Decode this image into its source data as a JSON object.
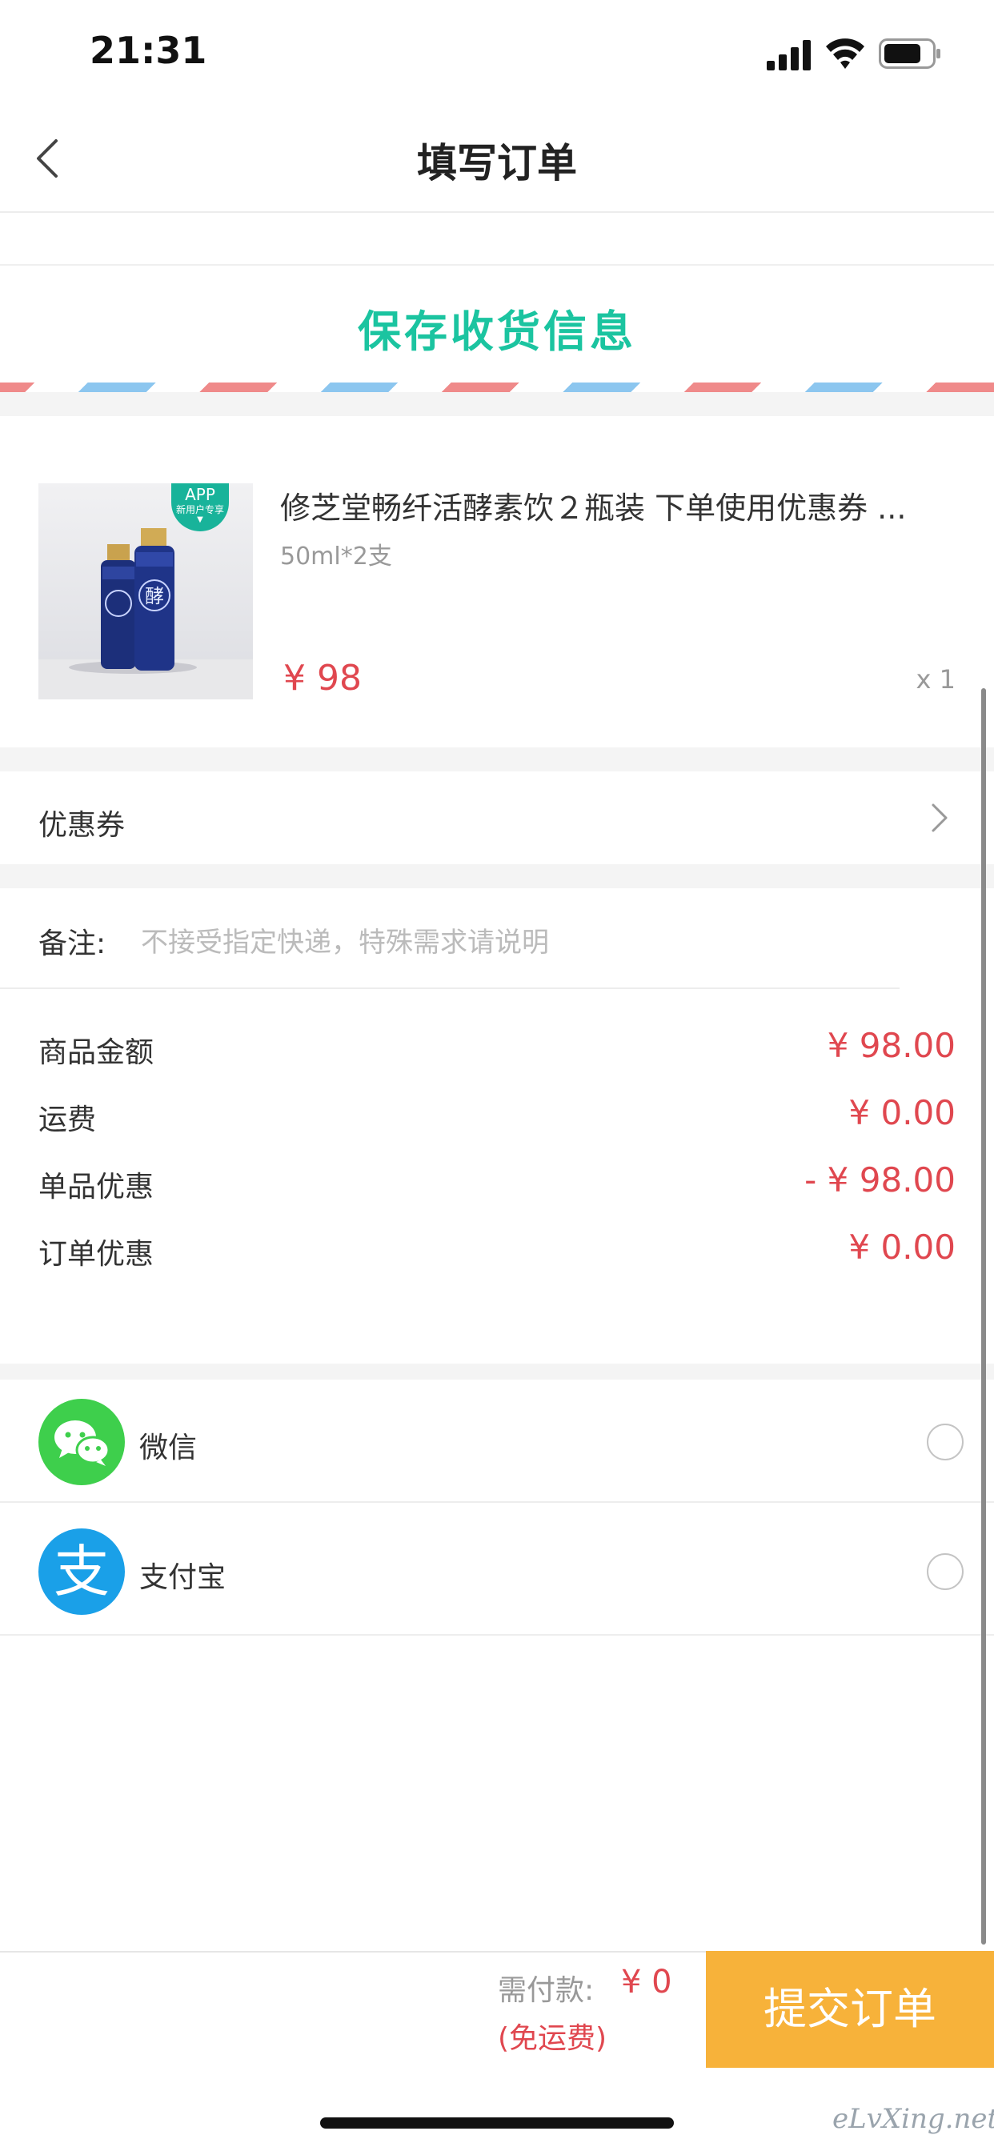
{
  "status_bar": {
    "time": "21:31"
  },
  "nav": {
    "title": "填写订单"
  },
  "address": {
    "save_label": "保存收货信息"
  },
  "product": {
    "name": "修芝堂畅纤活酵素饮２瓶装  下单使用优惠券 ...",
    "spec": "50ml*2支",
    "price": "¥ 98",
    "quantity": "x 1",
    "badge_line1": "APP",
    "badge_line2": "新用户专享",
    "bottle_char": "酵"
  },
  "coupon": {
    "label": "优惠券"
  },
  "note": {
    "label": "备注:",
    "placeholder": "不接受指定快递，特殊需求请说明"
  },
  "summary": [
    {
      "label": "商品金额",
      "value": "¥ 98.00"
    },
    {
      "label": "运费",
      "value": "¥ 0.00"
    },
    {
      "label": "单品优惠",
      "value": "- ¥ 98.00"
    },
    {
      "label": "订单优惠",
      "value": "¥ 0.00"
    }
  ],
  "payment": {
    "methods": [
      {
        "label": "微信",
        "icon": "wechat-icon",
        "color": "#3ecf4c"
      },
      {
        "label": "支付宝",
        "icon": "alipay-icon",
        "color": "#1aa0e8",
        "glyph": "支"
      }
    ]
  },
  "footer": {
    "need_pay_label": "需付款:",
    "need_pay_value": "¥ 0",
    "free_shipping": "(免运费)",
    "submit_label": "提交订单"
  },
  "watermark": "eLvXing.net",
  "colors": {
    "accent": "#1bc4a0",
    "price": "#e0474f",
    "submit": "#f7b23a"
  }
}
